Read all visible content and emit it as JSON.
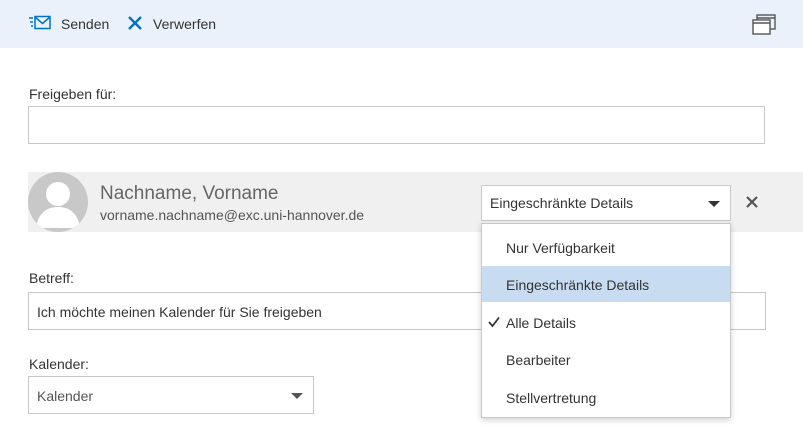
{
  "toolbar": {
    "send_label": "Senden",
    "discard_label": "Verwerfen",
    "send_icon": "send-mail-icon",
    "discard_icon": "close-x-icon",
    "popout_icon": "popout-window-icon"
  },
  "share": {
    "label": "Freigeben für:",
    "value": ""
  },
  "recipient": {
    "name": "Nachname, Vorname",
    "email": "vorname.nachname@exc.uni-hannover.de",
    "permission": "Eingeschränkte Details"
  },
  "permission_options": [
    {
      "label": "Nur Verfügbarkeit",
      "highlighted": false,
      "checked": false
    },
    {
      "label": "Eingeschränkte Details",
      "highlighted": true,
      "checked": false
    },
    {
      "label": "Alle Details",
      "highlighted": false,
      "checked": true
    },
    {
      "label": "Bearbeiter",
      "highlighted": false,
      "checked": false
    },
    {
      "label": "Stellvertretung",
      "highlighted": false,
      "checked": false
    }
  ],
  "subject": {
    "label": "Betreff:",
    "value": "Ich möchte meinen Kalender für Sie freigeben"
  },
  "calendar": {
    "label": "Kalender:",
    "value": "Kalender"
  },
  "colors": {
    "toolbar_bg": "#eaf1fa",
    "accent": "#0072c6",
    "highlight": "#c7dcf1"
  }
}
